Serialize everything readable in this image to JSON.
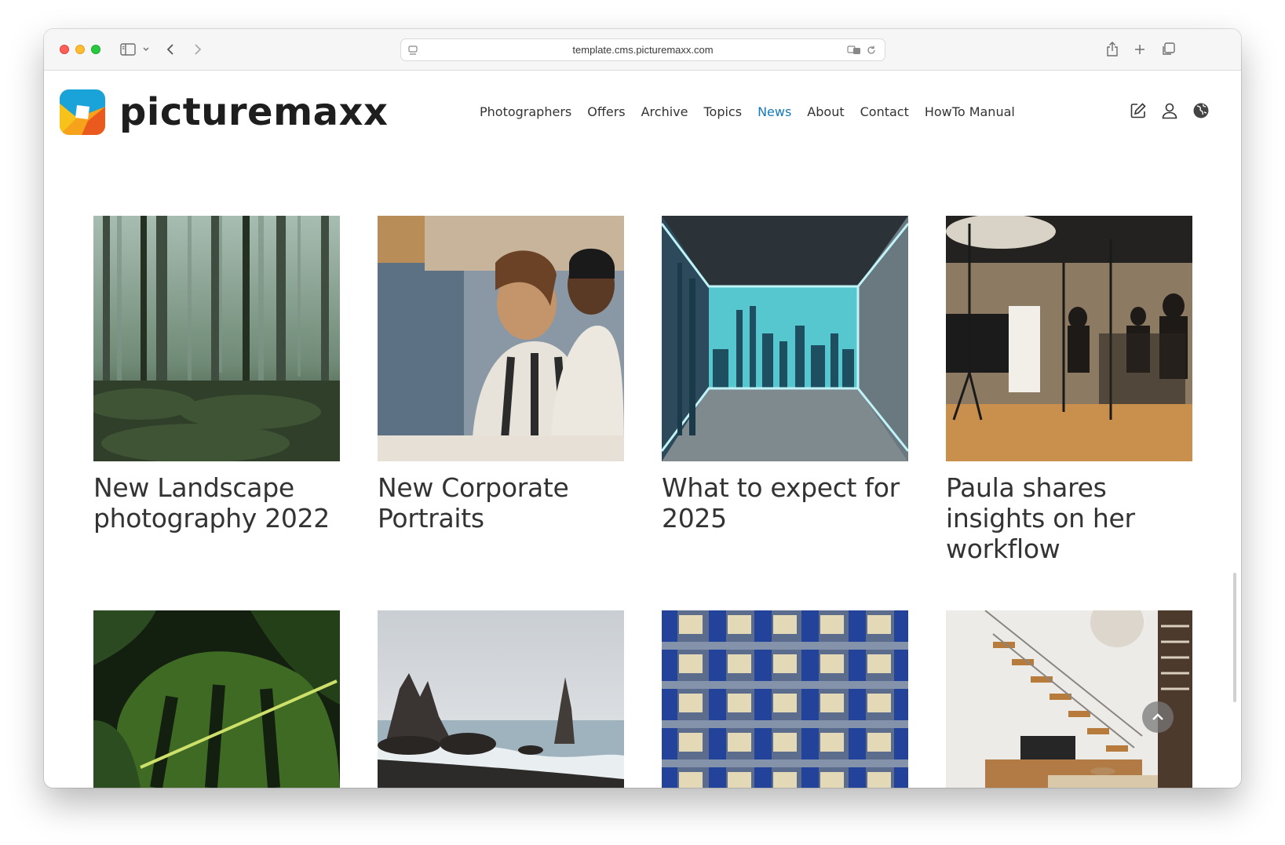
{
  "browser": {
    "url": "template.cms.picturemaxx.com",
    "icons": [
      "sidebar-icon",
      "chevron-down-icon",
      "back-icon",
      "forward-icon",
      "page-icon",
      "translate-icon",
      "reload-icon",
      "share-icon",
      "new-tab-icon",
      "tabs-icon"
    ]
  },
  "site": {
    "logo_text": "picturemaxx",
    "nav": [
      {
        "label": "Photographers",
        "active": false
      },
      {
        "label": "Offers",
        "active": false
      },
      {
        "label": "Archive",
        "active": false
      },
      {
        "label": "Topics",
        "active": false
      },
      {
        "label": "News",
        "active": true
      },
      {
        "label": "About",
        "active": false
      },
      {
        "label": "Contact",
        "active": false
      },
      {
        "label": "HowTo Manual",
        "active": false
      }
    ],
    "header_icons": [
      "edit-icon",
      "user-icon",
      "globe-icon"
    ],
    "accent_color": "#1479b8"
  },
  "articles": [
    {
      "title_line1": "New Landscape",
      "title_line2": "photography 2022",
      "title_line3": "",
      "image": "misty-forest"
    },
    {
      "title_line1": "New Corporate",
      "title_line2": "Portraits",
      "title_line3": "",
      "image": "colleagues-at-desk"
    },
    {
      "title_line1": "What to expect for",
      "title_line2": "2025",
      "title_line3": "",
      "image": "city-view-room"
    },
    {
      "title_line1": "Paula shares",
      "title_line2": "insights on her",
      "title_line3": "workflow",
      "image": "photo-studio"
    },
    {
      "title_line1": "",
      "title_line2": "",
      "title_line3": "",
      "image": "monstera-leaf"
    },
    {
      "title_line1": "",
      "title_line2": "",
      "title_line3": "",
      "image": "sea-stacks-beach"
    },
    {
      "title_line1": "",
      "title_line2": "",
      "title_line3": "",
      "image": "building-facade"
    },
    {
      "title_line1": "",
      "title_line2": "",
      "title_line3": "",
      "image": "loft-staircase"
    }
  ]
}
